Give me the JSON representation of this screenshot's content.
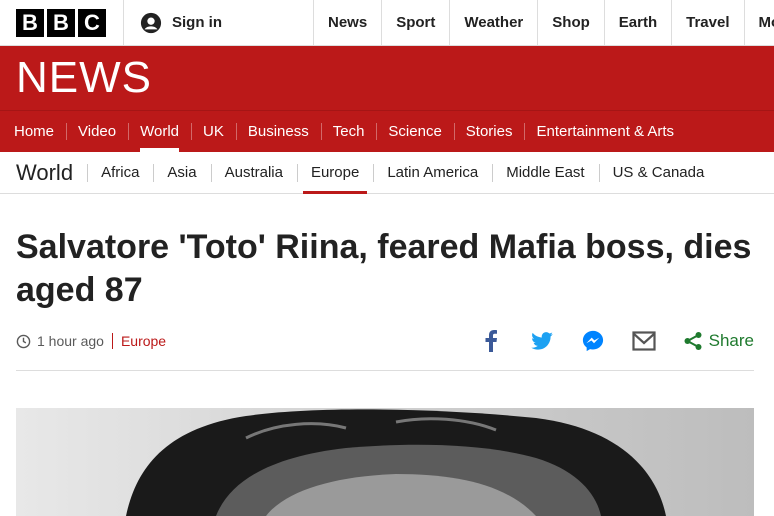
{
  "masthead": {
    "logo_letters": [
      "B",
      "B",
      "C"
    ],
    "signin_label": "Sign in",
    "nav": [
      "News",
      "Sport",
      "Weather",
      "Shop",
      "Earth",
      "Travel",
      "Mo"
    ]
  },
  "banner": {
    "title": "NEWS"
  },
  "main_nav": {
    "items": [
      "Home",
      "Video",
      "World",
      "UK",
      "Business",
      "Tech",
      "Science",
      "Stories",
      "Entertainment & Arts"
    ],
    "active": "World"
  },
  "section_nav": {
    "title": "World",
    "items": [
      "Africa",
      "Asia",
      "Australia",
      "Europe",
      "Latin America",
      "Middle East",
      "US & Canada"
    ],
    "active": "Europe"
  },
  "article": {
    "headline": "Salvatore 'Toto' Riina, feared Mafia boss, dies aged 87",
    "time": "1 hour ago",
    "section": "Europe",
    "share_label": "Share"
  },
  "colors": {
    "brand_red": "#bb1919",
    "share_green": "#1f7a2e",
    "link_blue": "#3b5998"
  }
}
